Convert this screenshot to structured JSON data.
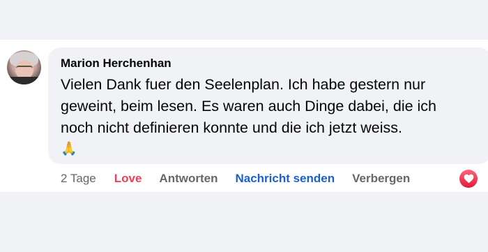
{
  "comment": {
    "author": "Marion Herchenhan",
    "text": "Vielen Dank fuer den Seelenplan. Ich habe gestern nur geweint, beim lesen. Es waren auch Dinge dabei, die ich noch nicht definieren konnte und die ich jetzt weiss.",
    "emoji": "🙏",
    "avatar_icon": "profile-photo"
  },
  "actions": {
    "time": "2 Tage",
    "love": "Love",
    "reply": "Antworten",
    "send_message": "Nachricht senden",
    "hide": "Verbergen"
  },
  "reaction": {
    "icon": "love-heart-icon",
    "color": "#f33e58"
  },
  "colors": {
    "background": "#f0f2f5",
    "bubble": "#f0f2f5",
    "love": "#f33e58",
    "link": "#1b5fd1",
    "secondary": "#65676b"
  }
}
